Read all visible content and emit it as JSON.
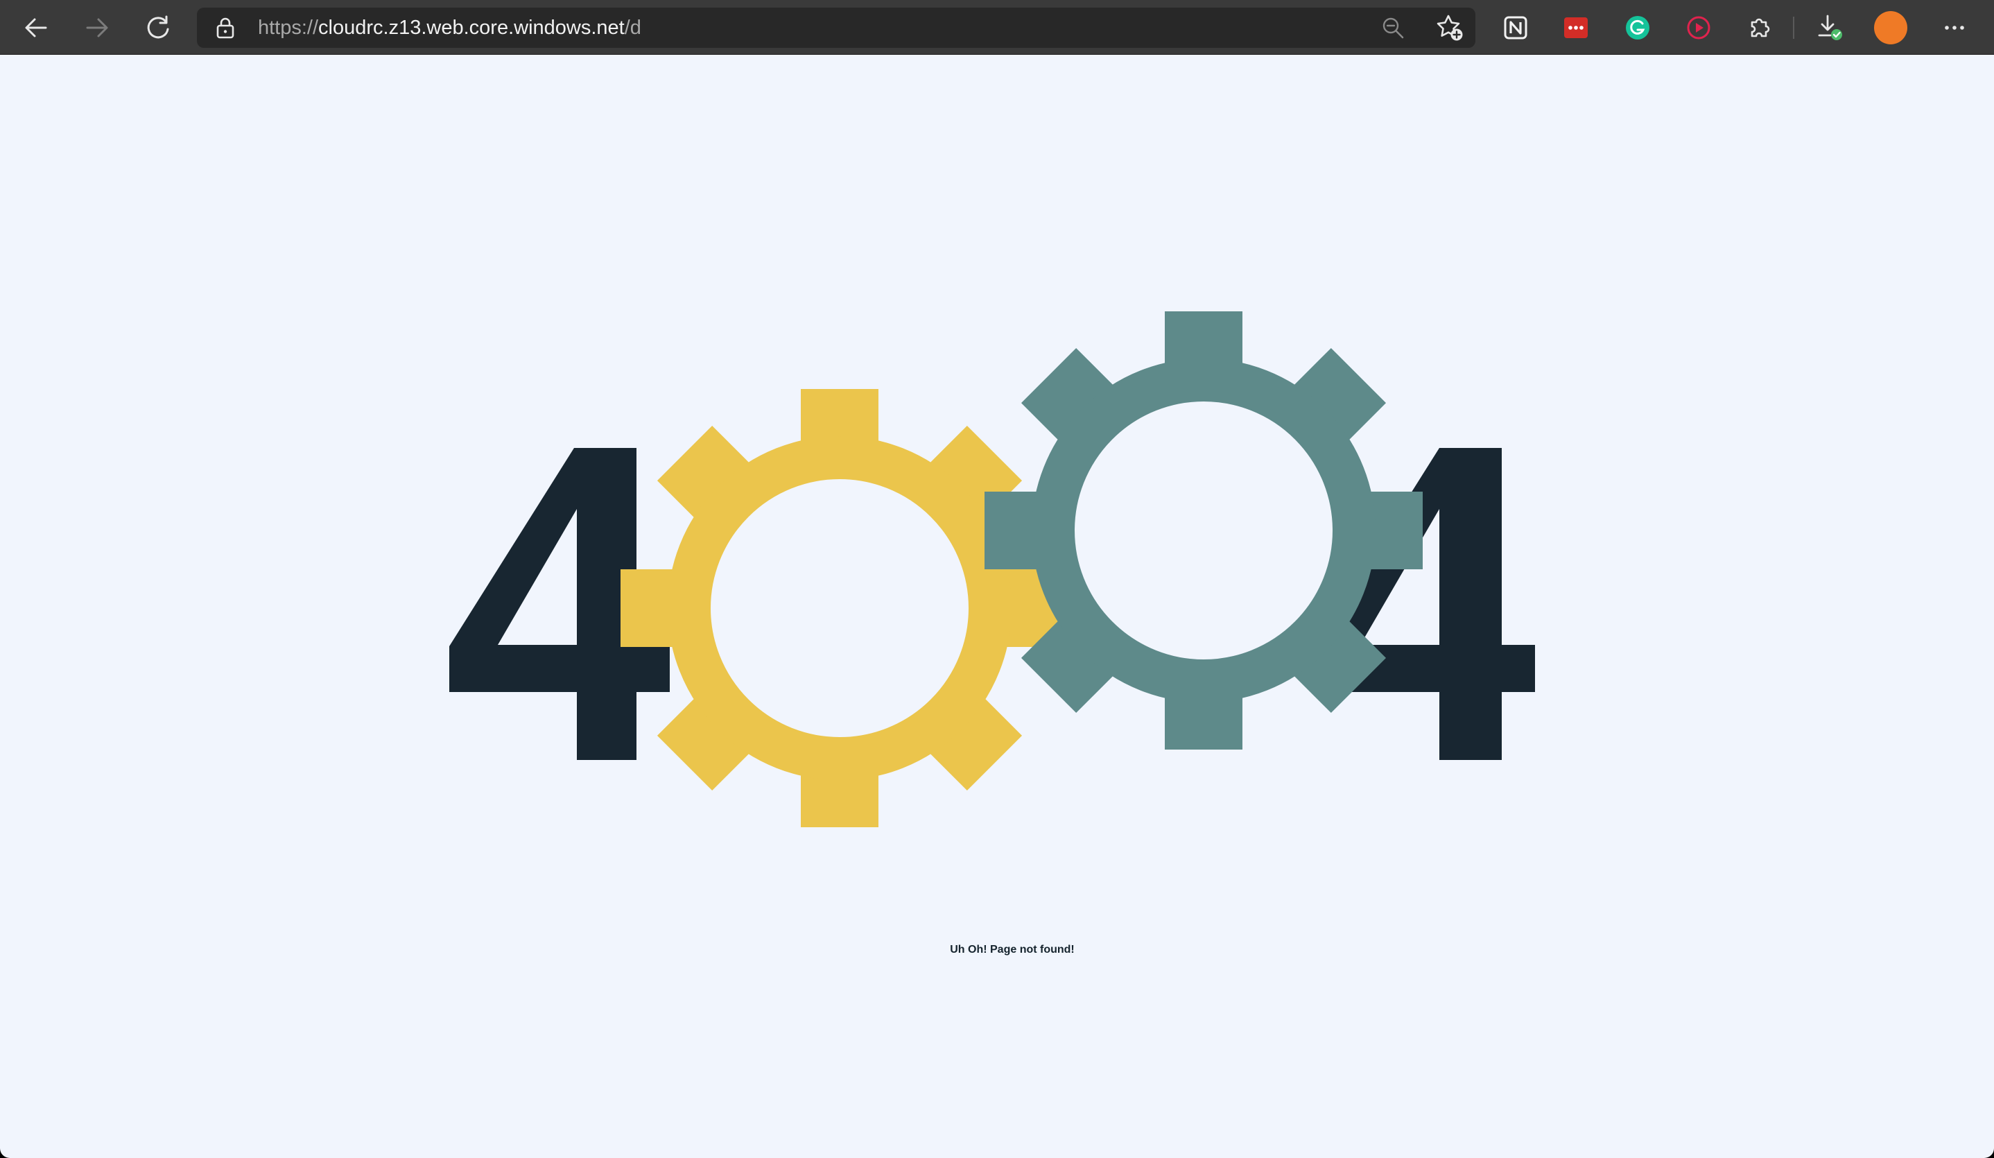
{
  "browser": {
    "url": {
      "scheme": "https://",
      "host": "cloudrc.z13.web.core.windows.net",
      "path": "/d"
    },
    "buttons": {
      "back": "back-icon",
      "forward": "forward-icon",
      "reload": "reload-icon",
      "zoom": "zoom-out-icon",
      "favorite": "add-favorite-icon",
      "extensions": "extensions-icon",
      "downloads": "downloads-icon",
      "menu": "more-icon"
    },
    "extensions": [
      {
        "name": "notion-icon",
        "color": "#f2f2f2"
      },
      {
        "name": "lastpass-icon",
        "color": "#d32d27"
      },
      {
        "name": "grammarly-icon",
        "color": "#15c39a"
      },
      {
        "name": "video-record-icon",
        "color": "#e0234e"
      }
    ],
    "avatar_color": "#ef7a26"
  },
  "page": {
    "digits": [
      "4",
      "0",
      "4"
    ],
    "message": "Uh Oh! Page not found!",
    "colors": {
      "background": "#f1f5fd",
      "digit": "#182631",
      "gear_left": "#ebc54c",
      "gear_right": "#5e8a8a"
    }
  }
}
